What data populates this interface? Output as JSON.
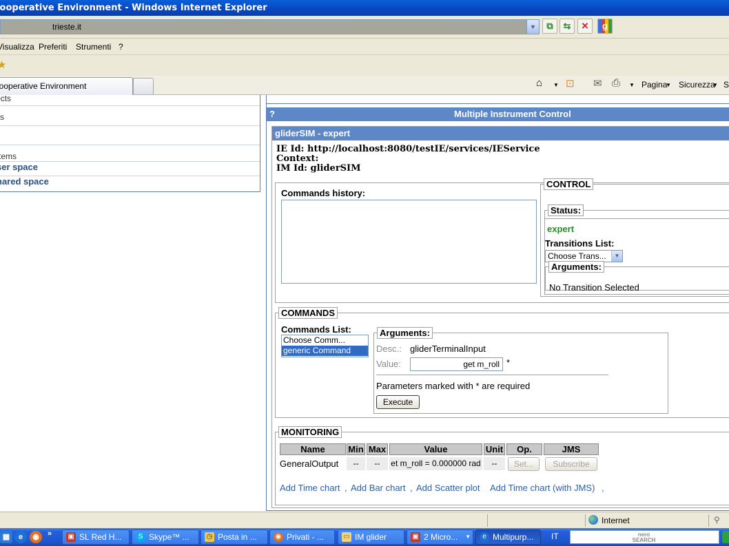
{
  "window": {
    "title": "Cooperative Environment - Windows Internet Explorer"
  },
  "address": {
    "value": "trieste.it"
  },
  "menu": {
    "items": [
      "Visualizza",
      "Preferiti",
      "Strumenti",
      "?"
    ]
  },
  "tab": {
    "label": "Cooperative Environment"
  },
  "commandbar": {
    "page": "Pagina",
    "security": "Sicurezza",
    "more": "S"
  },
  "left_panel": {
    "items": [
      "ects",
      "rs",
      "",
      "tems"
    ],
    "links": [
      "ser space",
      "hared space"
    ]
  },
  "mic": {
    "help": "?",
    "title": "Multiple Instrument Control"
  },
  "instrument": {
    "header": "gliderSIM - expert",
    "ie_id": "IE Id: http://localhost:8080/testIE/services/IEService",
    "context": "Context:",
    "im_id": "IM Id: gliderSIM"
  },
  "history": {
    "label": "Commands history:"
  },
  "control": {
    "legend": "CONTROL",
    "status_legend": "Status:",
    "status_value": "expert",
    "transitions_label": "Transitions List:",
    "transitions_select": "Choose Trans...",
    "arguments_legend": "Arguments:",
    "arguments_text": "No Transition Selected"
  },
  "commands": {
    "legend": "COMMANDS",
    "list_label": "Commands List:",
    "options": [
      "Choose Comm...",
      "generic Command"
    ],
    "arguments_legend": "Arguments:",
    "desc_label": "Desc.:",
    "desc_value": "gliderTerminalInput",
    "value_label": "Value:",
    "value_input": "get m_roll",
    "required_mark": "*",
    "note": "Parameters marked with * are required",
    "execute": "Execute"
  },
  "monitoring": {
    "legend": "MONITORING",
    "headers": [
      "Name",
      "Min",
      "Max",
      "Value",
      "Unit",
      "Op.",
      "JMS"
    ],
    "row": {
      "name": "GeneralOutput",
      "min": "--",
      "max": "--",
      "value": "et m_roll = 0.000000 rad",
      "unit": "--",
      "set": "Set...",
      "subscribe": "Subscribe"
    },
    "links": [
      "Add Time chart",
      "Add Bar chart",
      "Add Scatter plot",
      "Add Time chart (with JMS)"
    ],
    "sep": ",",
    "trail": ","
  },
  "status": {
    "zone": "Internet"
  },
  "taskbar": {
    "tasks": [
      "SL Red H...",
      "Skype™ ...",
      "Posta in ...",
      "Privati - ...",
      "IM glider",
      "2 Micro...",
      "Multipurp..."
    ],
    "lang": "IT",
    "search_logo": "nero SEARCH"
  },
  "colors": {
    "header_blue": "#5e87c7",
    "status_green": "#2a8a2a",
    "link_blue": "#2a5fa8",
    "selection": "#316ac5"
  }
}
